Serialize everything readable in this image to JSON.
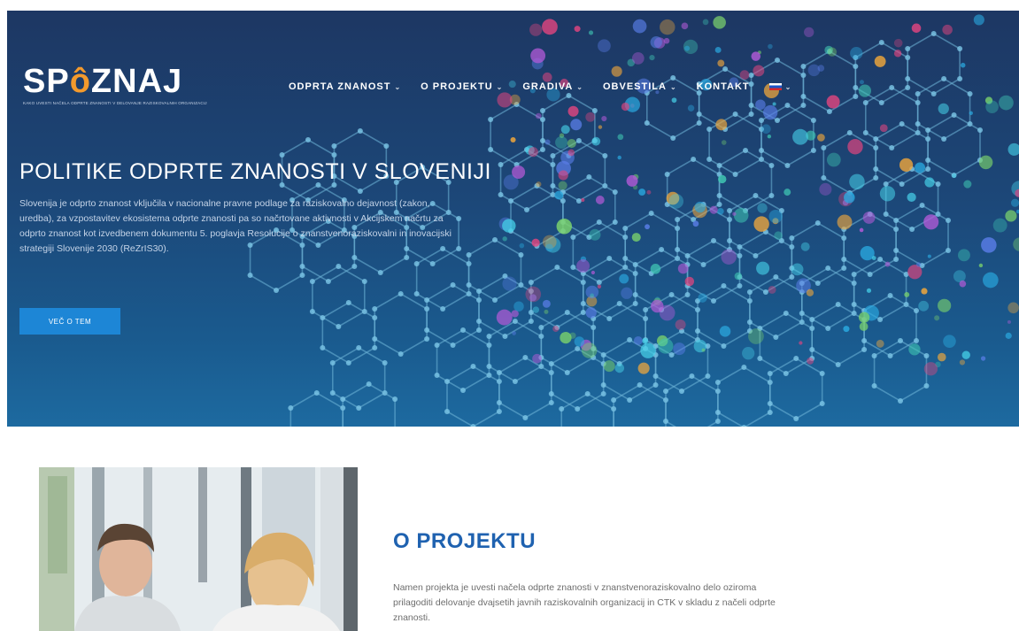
{
  "header": {
    "logo_text": "SPOZNAJ",
    "logo_tagline": "KAKO UVESTI NAČELA ODPRTE ZNANOSTI V DELOVANJE RAZISKOVALNIH ORGANIZACIJ",
    "nav": [
      {
        "label": "ODPRTA ZNANOST"
      },
      {
        "label": "O PROJEKTU"
      },
      {
        "label": "GRADIVA"
      },
      {
        "label": "OBVESTILA"
      },
      {
        "label": "KONTAKT"
      }
    ],
    "language_flag": "slovenian-flag-icon"
  },
  "hero": {
    "title": "POLITIKE ODPRTE ZNANOSTI V SLOVENIJI",
    "description": "Slovenija je odprto znanost vključila v nacionalne pravne podlage za raziskovalno dejavnost (zakon, uredba), za vzpostavitev ekosistema odprte znanosti pa so načrtovane aktivnosti v Akcijskem načrtu za odprto znanost kot izvedbenem dokumentu 5. poglavja Resolucije o znanstvenoraziskovalni in inovacijski strategiji Slovenije 2030 (ReZrIS30).",
    "button_label": "VEČ O TEM"
  },
  "about": {
    "title": "O PROJEKTU",
    "text": "Namen projekta je uvesti načela odprte znanosti v znanstvenoraziskovalno delo oziroma prilagoditi delovanje dvajsetih javnih raziskovalnih organizacij in CTK v skladu z načeli odprte znanosti."
  },
  "colors": {
    "hero_bg": "#1c4778",
    "accent_blue": "#1d86d6",
    "section_title": "#1f62b0",
    "logo_accent": "#f39a2d"
  }
}
